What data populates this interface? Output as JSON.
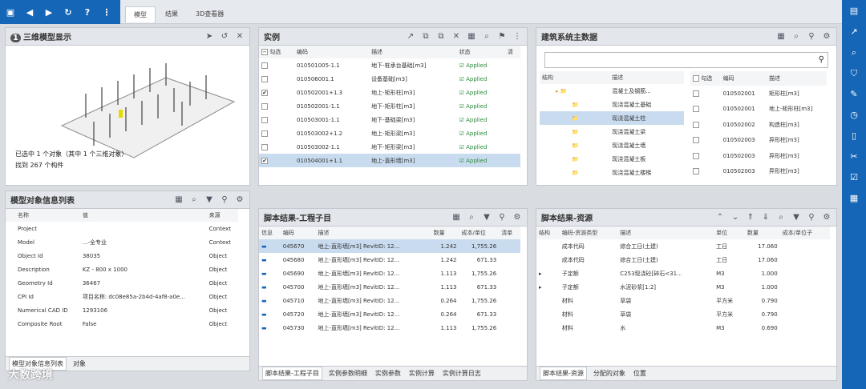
{
  "tabs": [
    "模型",
    "结果",
    "3D查看器"
  ],
  "left_top": {
    "title": "三维模型显示",
    "badge": "1",
    "selected_text": "已选中 1 个对象（其中 1 个三维对象）",
    "found_text": "找到 267 个构件"
  },
  "left_bottom": {
    "title": "模型对象信息列表",
    "headers": [
      "名称",
      "值",
      "来源"
    ],
    "rows": [
      [
        "Project",
        "",
        "Context"
      ],
      [
        "Model",
        "...-全专业",
        "Context"
      ],
      [
        "Object Id",
        "38035",
        "Object"
      ],
      [
        "Description",
        "KZ - 800 x 1000",
        "Object"
      ],
      [
        "Geometry Id",
        "36467",
        "Object"
      ],
      [
        "CPI Id",
        "项目名称: dc08e85a-2b4d-4af8-a0e...",
        "Object"
      ],
      [
        "Numerical CAD ID",
        "1293106",
        "Object"
      ],
      [
        "Composite Root",
        "False",
        "Object"
      ]
    ],
    "tabs": [
      "模型对象信息列表",
      "对象"
    ]
  },
  "mid_top": {
    "title": "实例",
    "headers": [
      "勾选",
      "编码",
      "描述",
      "状态",
      "清"
    ],
    "rows": [
      {
        "checked": false,
        "code": "010501005-1.1",
        "desc": "地下-桩承台基础[m3]",
        "status": "Applied"
      },
      {
        "checked": false,
        "code": "010506001.1",
        "desc": "设备基础[m3]",
        "status": "Applied"
      },
      {
        "checked": true,
        "code": "010502001+1.3",
        "desc": "地上-矩形柱[m3]",
        "status": "Applied"
      },
      {
        "checked": false,
        "code": "010502001-1.1",
        "desc": "地下-矩形柱[m3]",
        "status": "Applied"
      },
      {
        "checked": false,
        "code": "010503001-1.1",
        "desc": "地下-基础梁[m3]",
        "status": "Applied"
      },
      {
        "checked": false,
        "code": "010503002+1.2",
        "desc": "地上-矩形梁[m3]",
        "status": "Applied"
      },
      {
        "checked": false,
        "code": "010503002-1.1",
        "desc": "地下-矩形梁[m3]",
        "status": "Applied"
      },
      {
        "checked": true,
        "code": "010504001+1.1",
        "desc": "地上-直形墙[m3]",
        "status": "Applied"
      }
    ]
  },
  "mid_bottom": {
    "title": "脚本结果-工程子目",
    "headers": [
      "信息",
      "编码",
      "描述",
      "数量",
      "成本/单位",
      "清单"
    ],
    "rows": [
      [
        "045670",
        "地上-直形墙[m3] RevitID: 12...",
        "1.242",
        "1,755.26"
      ],
      [
        "045680",
        "地上-直形墙[m3] RevitID: 12...",
        "1.242",
        "671.33"
      ],
      [
        "045690",
        "地上-直形墙[m3] RevitID: 12...",
        "1.113",
        "1,755.26"
      ],
      [
        "045700",
        "地上-直形墙[m3] RevitID: 12...",
        "1.113",
        "671.33"
      ],
      [
        "045710",
        "地上-直形墙[m3] RevitID: 12...",
        "0.264",
        "1,755.26"
      ],
      [
        "045720",
        "地上-直形墙[m3] RevitID: 12...",
        "0.264",
        "671.33"
      ],
      [
        "045730",
        "地上-直形墙[m3] RevitID: 12...",
        "1.113",
        "1,755.26"
      ]
    ],
    "tabs": [
      "脚本结果-工程子目",
      "实例参数明细",
      "实例参数",
      "实例计算",
      "实例计算日志"
    ]
  },
  "right_top": {
    "title": "建筑系统主数据",
    "tree_headers": [
      "结构",
      "描述"
    ],
    "tree": [
      "混凝土及钢筋...",
      "现浇混凝土基础",
      "现浇混凝土柱",
      "现浇混凝土梁",
      "现浇混凝土墙",
      "现浇混凝土板",
      "现浇混凝土楼梯"
    ],
    "list_headers": [
      "勾选",
      "编码",
      "描述"
    ],
    "list": [
      [
        "010502001",
        "矩形柱[m3]"
      ],
      [
        "010502001",
        "地上-矩形柱[m3]"
      ],
      [
        "010502002",
        "构造柱[m3]"
      ],
      [
        "010502003",
        "异形柱[m3]"
      ],
      [
        "010502003",
        "异形柱[m3]"
      ],
      [
        "010502003",
        "异形柱[m3]"
      ]
    ]
  },
  "right_bottom": {
    "title": "脚本结果-资源",
    "headers": [
      "结构",
      "编码-资源类型",
      "描述",
      "单位",
      "数量",
      "成本/单位子"
    ],
    "rows": [
      [
        "",
        "成本代码",
        "综合工日(土建)",
        "工日",
        "17.060"
      ],
      [
        "",
        "成本代码",
        "综合工日(土建)",
        "工日",
        "17.060"
      ],
      [
        "▸",
        "子定额",
        "C253现浇砼[碎石&lt;31...",
        "M3",
        "1.000"
      ],
      [
        "▸",
        "子定额",
        "水泥砂浆[1:2]",
        "M3",
        "1.000"
      ],
      [
        "",
        "材料",
        "草袋",
        "平方米",
        "0.790"
      ],
      [
        "",
        "材料",
        "草袋",
        "平方米",
        "0.790"
      ],
      [
        "",
        "材料",
        "水",
        "M3",
        "0.690"
      ]
    ],
    "tabs": [
      "脚本结果-资源",
      "分配的对象",
      "位置"
    ]
  },
  "watermark": "大数跨境"
}
